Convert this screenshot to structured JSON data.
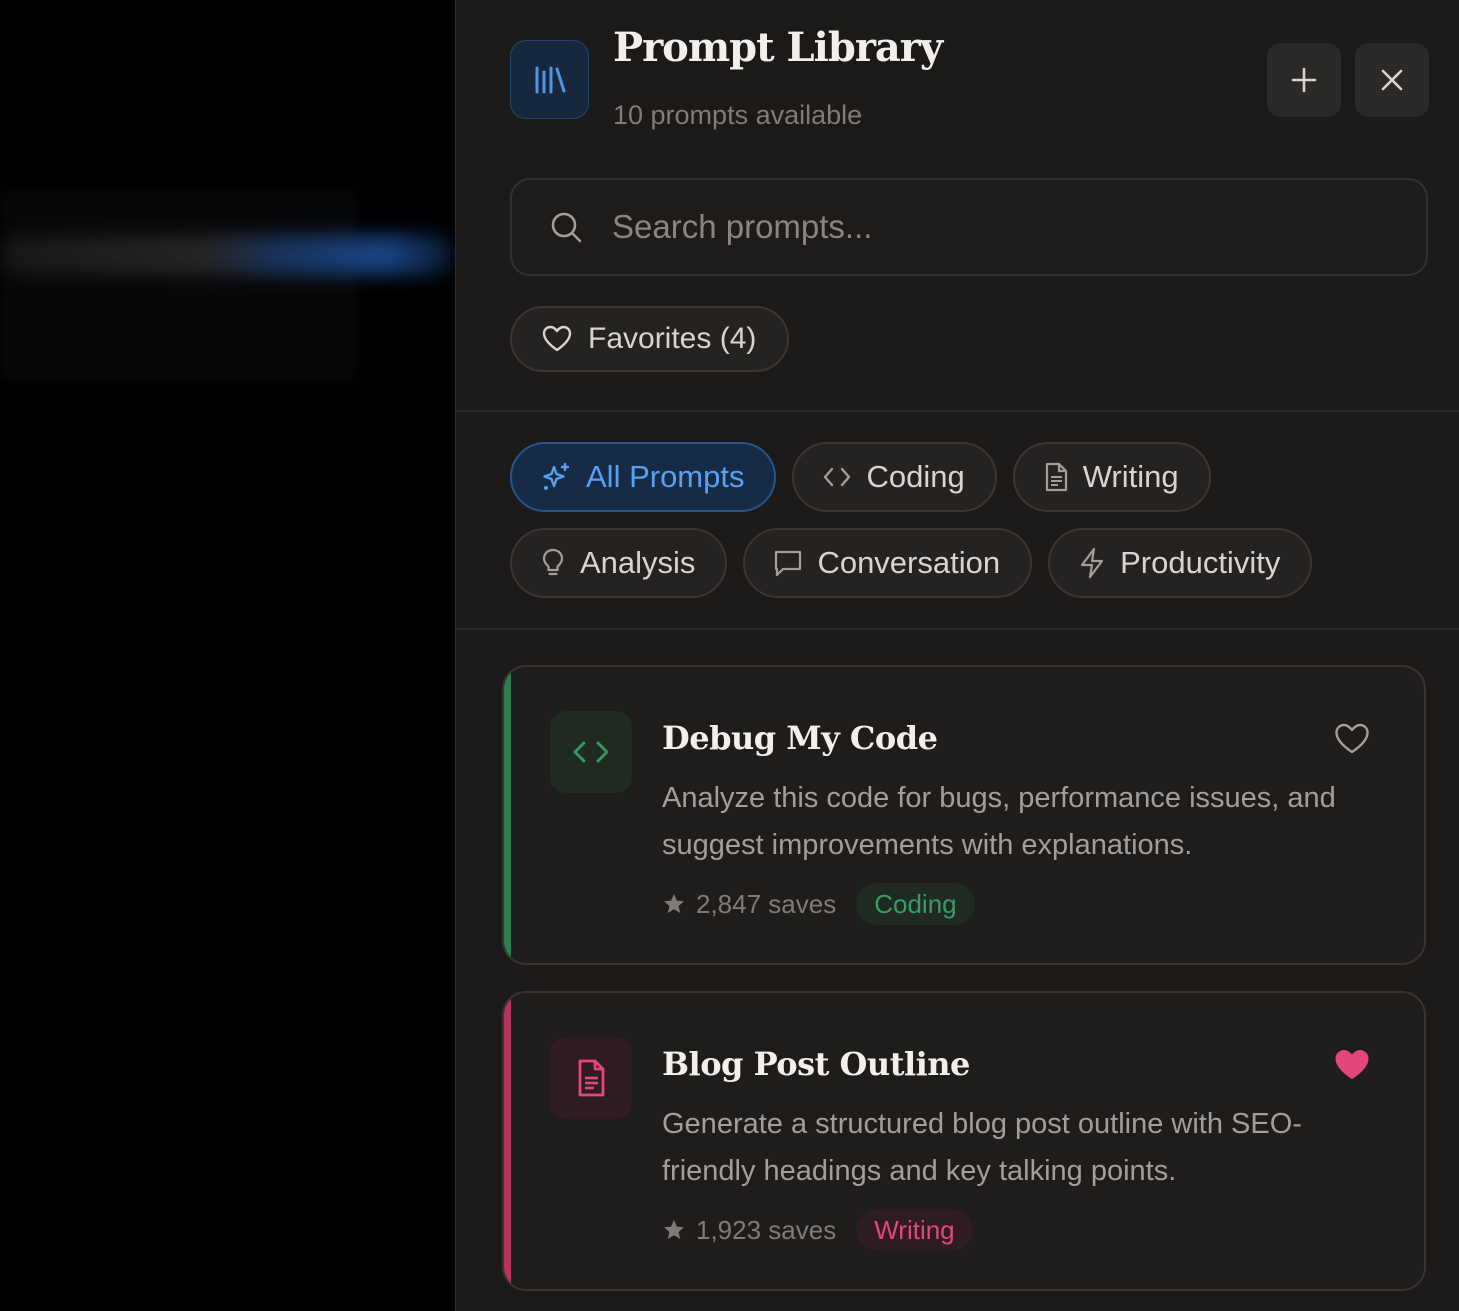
{
  "header": {
    "title": "Prompt Library",
    "subtitle": "10 prompts available",
    "app_icon": "library-icon",
    "add_icon": "plus-icon",
    "close_icon": "close-icon"
  },
  "search": {
    "placeholder": "Search prompts...",
    "value": "",
    "icon": "search-icon"
  },
  "favorites": {
    "label": "Favorites (4)",
    "icon": "heart-outline-icon"
  },
  "categories": [
    {
      "label": "All Prompts",
      "icon": "sparkles-icon",
      "active": true
    },
    {
      "label": "Coding",
      "icon": "code-icon",
      "active": false
    },
    {
      "label": "Writing",
      "icon": "document-icon",
      "active": false
    },
    {
      "label": "Analysis",
      "icon": "lightbulb-icon",
      "active": false
    },
    {
      "label": "Conversation",
      "icon": "chat-bubble-icon",
      "active": false
    },
    {
      "label": "Productivity",
      "icon": "lightning-icon",
      "active": false
    }
  ],
  "prompts": [
    {
      "title": "Debug My Code",
      "description": "Analyze this code for bugs, performance issues, and suggest improvements with explanations.",
      "saves": "2,847 saves",
      "tag": "Coding",
      "favorited": false,
      "icon": "code-icon",
      "accent": "#2f7d4f"
    },
    {
      "title": "Blog Post Outline",
      "description": "Generate a structured blog post outline with SEO-friendly headings and key talking points.",
      "saves": "1,923 saves",
      "tag": "Writing",
      "favorited": true,
      "icon": "document-icon",
      "accent": "#b8325e"
    }
  ],
  "colors": {
    "accent_blue": "#58a0f0",
    "coding_green": "#3b9a63",
    "writing_pink": "#e2467d",
    "panel_bg": "#1b1a19"
  }
}
